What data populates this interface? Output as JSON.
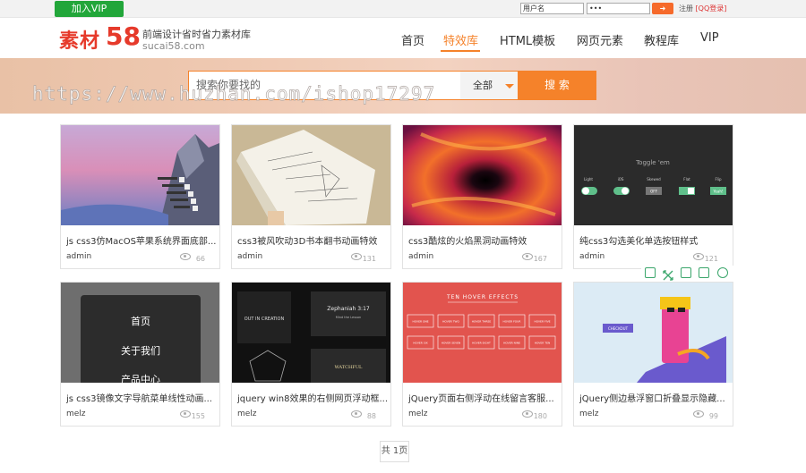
{
  "topbar": {
    "vip_button": "加入VIP",
    "username_value": "用户名",
    "password_value": "•••",
    "register_label": "注册",
    "qq_login_label": "[QQ登录]"
  },
  "header": {
    "logo_text": "素材",
    "logo_number": "58",
    "slogan": "前端设计省时省力素材库",
    "domain": "sucai58.com",
    "nav": [
      "首页",
      "特效库",
      "HTML模板",
      "网页元素",
      "教程库",
      "VIP"
    ],
    "active_nav": "特效库"
  },
  "search": {
    "placeholder": "搜索你要找的",
    "category": "全部",
    "button": "搜 索"
  },
  "watermark": "https://www.huzhan.com/ishop17297",
  "cards": [
    {
      "title": "js css3仿MacOS苹果系统界面底部...",
      "author": "admin",
      "views": "66"
    },
    {
      "title": "css3被风吹动3D书本翻书动画特效",
      "author": "admin",
      "views": "131"
    },
    {
      "title": "css3酷炫的火焰黑洞动画特效",
      "author": "admin",
      "views": "167"
    },
    {
      "title": "纯css3勾选美化单选按钮样式",
      "author": "admin",
      "views": "121"
    },
    {
      "title": "js css3镜像文字导航菜单线性动画...",
      "author": "melz",
      "views": "155"
    },
    {
      "title": "jquery win8效果的右侧网页浮动框...",
      "author": "melz",
      "views": "88"
    },
    {
      "title": "jQuery页面右侧浮动在线留言客服...",
      "author": "melz",
      "views": "180"
    },
    {
      "title": "jQuery侧边悬浮窗口折叠显示隐藏...",
      "author": "melz",
      "views": "99"
    }
  ],
  "thumb_text": {
    "toggle_title": "Toggle 'em",
    "toggle_labels": [
      "Light",
      "iOS",
      "Skewed",
      "Flat",
      "Flip"
    ],
    "toggle_off": "OFF",
    "toggle_yeah": "Yeah!",
    "menu_items": [
      "首页",
      "关于我们",
      "产品中心"
    ],
    "zephaniah": "Zephaniah 3:17",
    "zeph_sub": "Mind the Lesson",
    "win8_left": "OUT IN CREATION",
    "hover_title": "TEN HOVER EFFECTS",
    "hover_buttons": [
      "HOVER ONE",
      "HOVER TWO",
      "HOVER THREE",
      "HOVER FOUR",
      "HOVER FIVE",
      "HOVER SIX",
      "HOVER SEVEN",
      "HOVER EIGHT",
      "HOVER NINE",
      "HOVER TEN"
    ],
    "checkout": "CHECKOUT"
  },
  "pager": "共 1页",
  "colors": {
    "accent": "#f5822a",
    "vip_green": "#22a63a",
    "logo_red": "#e63a2b"
  }
}
